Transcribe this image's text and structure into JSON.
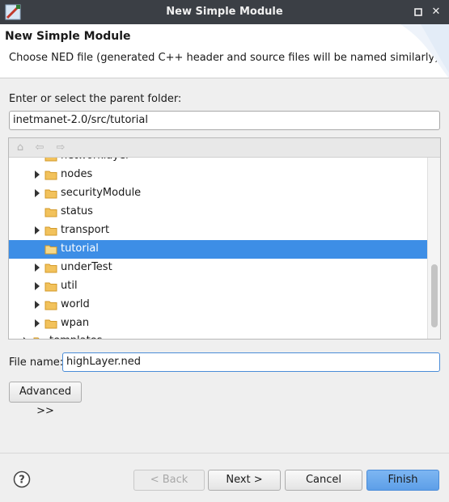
{
  "window": {
    "title": "New Simple Module",
    "minimize_glyph": "▫",
    "close_glyph": "✕",
    "icon": "omnet-app-icon"
  },
  "banner": {
    "heading": "New Simple Module",
    "description": "Choose NED file (generated C++ header and source files will be named similarly)"
  },
  "parent_folder": {
    "label": "Enter or select the parent folder:",
    "value": "inetmanet-2.0/src/tutorial"
  },
  "tree": {
    "toolbar": {
      "home_icon": "⌂",
      "back_icon": "⇦",
      "forward_icon": "⇨"
    },
    "partial_top_label": "networklayer",
    "partial_bottom_label": "templates",
    "items": [
      {
        "label": "nodes",
        "expandable": true,
        "selected": false
      },
      {
        "label": "securityModule",
        "expandable": true,
        "selected": false
      },
      {
        "label": "status",
        "expandable": false,
        "selected": false
      },
      {
        "label": "transport",
        "expandable": true,
        "selected": false
      },
      {
        "label": "tutorial",
        "expandable": false,
        "selected": true
      },
      {
        "label": "underTest",
        "expandable": true,
        "selected": false
      },
      {
        "label": "util",
        "expandable": true,
        "selected": false
      },
      {
        "label": "world",
        "expandable": true,
        "selected": false
      },
      {
        "label": "wpan",
        "expandable": true,
        "selected": false
      }
    ]
  },
  "file_name": {
    "label": "File name:",
    "value": "highLayer.ned"
  },
  "buttons": {
    "advanced": "Advanced >>",
    "back": "< Back",
    "next": "Next >",
    "cancel": "Cancel",
    "finish": "Finish"
  },
  "colors": {
    "selection": "#3d8ee6",
    "folder": "#e9a93a",
    "titlebar": "#3b3f45",
    "primary_button": "#5d9fe8"
  }
}
